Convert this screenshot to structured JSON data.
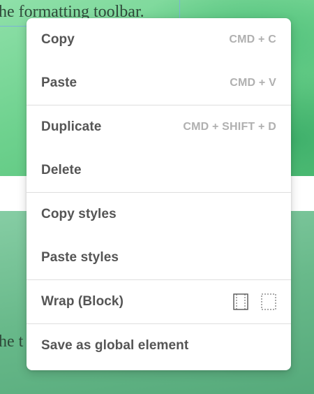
{
  "background": {
    "top_text": "he formatting toolbar.",
    "bottom_text": "he t"
  },
  "context_menu": {
    "groups": [
      {
        "items": [
          {
            "label": "Copy",
            "shortcut": "CMD + C"
          },
          {
            "label": "Paste",
            "shortcut": "CMD + V"
          }
        ]
      },
      {
        "items": [
          {
            "label": "Duplicate",
            "shortcut": "CMD + SHIFT + D"
          },
          {
            "label": "Delete",
            "shortcut": ""
          }
        ]
      },
      {
        "items": [
          {
            "label": "Copy styles",
            "shortcut": ""
          },
          {
            "label": "Paste styles",
            "shortcut": ""
          }
        ]
      },
      {
        "items": [
          {
            "label": "Wrap (Block)",
            "icons": [
              "wrap-block-solid-icon",
              "wrap-block-dotted-icon"
            ]
          }
        ]
      },
      {
        "items": [
          {
            "label": "Save as global element",
            "shortcut": ""
          }
        ]
      }
    ]
  }
}
